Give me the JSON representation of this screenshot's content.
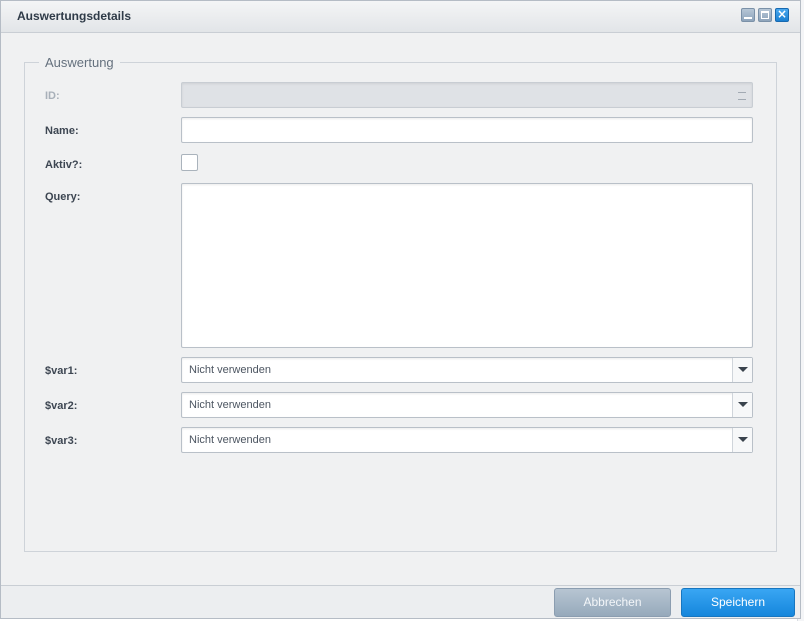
{
  "window": {
    "title": "Auswertungsdetails",
    "controls": [
      "minimize-icon",
      "maximize-icon",
      "close-icon"
    ]
  },
  "form": {
    "group_title": "Auswertung",
    "id": {
      "label": "ID:",
      "value": ""
    },
    "name": {
      "label": "Name:",
      "value": ""
    },
    "active": {
      "label": "Aktiv?:",
      "checked": false
    },
    "query": {
      "label": "Query:",
      "value": ""
    },
    "var1": {
      "label": "$var1:",
      "value": "Nicht verwenden"
    },
    "var2": {
      "label": "$var2:",
      "value": "Nicht verwenden"
    },
    "var3": {
      "label": "$var3:",
      "value": "Nicht verwenden"
    }
  },
  "buttons": {
    "cancel": "Abbrechen",
    "save": "Speichern"
  },
  "colors": {
    "accent": "#1a87dc",
    "panel_background": "#f0f1f2"
  }
}
